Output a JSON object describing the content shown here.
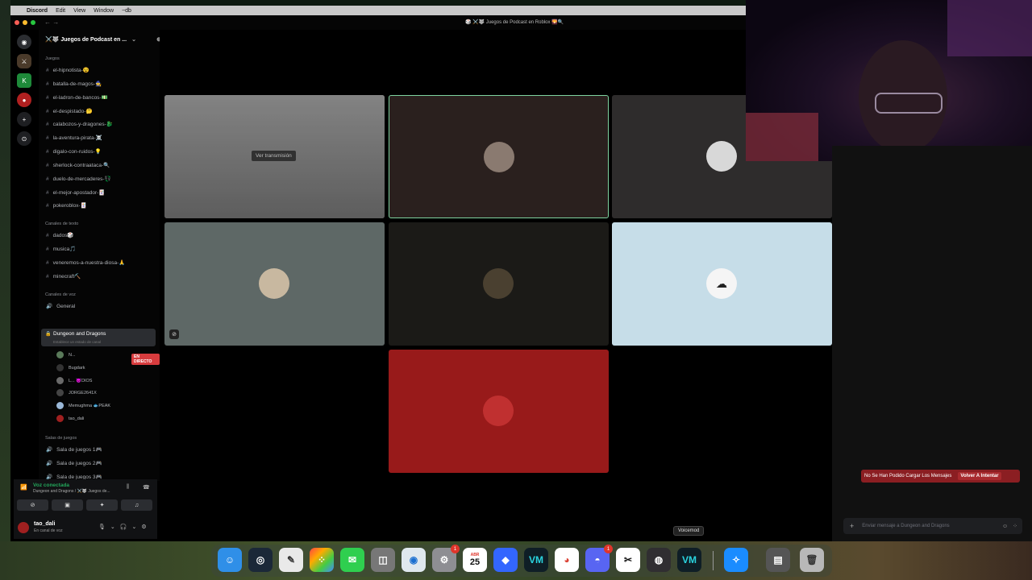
{
  "menubar": {
    "app": "Discord",
    "items": [
      "Edit",
      "View",
      "Window",
      "~db"
    ]
  },
  "window": {
    "title": "🎲 ⚔️🐺 Juegos de Podcast en Roblox 🌄🔍"
  },
  "server": {
    "name": "⚔️🐺 Juegos de Podcast en ..."
  },
  "categories": {
    "juegos": "Juegos",
    "texto": "Canales de texto",
    "voz": "Canales de voz",
    "salas": "Salas de juegos"
  },
  "channels_juegos": [
    "el-hipnotista-😵",
    "batalla-de-magos-🧙",
    "el-ladron-de-bancos-💵",
    "el-despistado-🤔",
    "calabozos-y-dragones-🐉",
    "la-aventura-pirata-☠️",
    "digalo-con-ruidos-💡",
    "sherlock-contraataca-🔍",
    "duelo-de-mercaderes-💱",
    "el-mejor-apostador-🃏",
    "pokeroblox-🃏"
  ],
  "channels_texto": [
    "dados🎲",
    "musica🎵",
    "veneremos-a-nuestra-diosa-🙏",
    "minecraft⛏️"
  ],
  "channels_voz": {
    "general": "General",
    "active": "Dungeon and Dragons",
    "active_sub": "Establece un estado de canal"
  },
  "voice_users": [
    {
      "name": "N...",
      "color": "#5a7a5a"
    },
    {
      "name": "Bugdark",
      "color": "#333333"
    },
    {
      "name": "L... 😈DIOS",
      "color": "#6a6a6a"
    },
    {
      "name": "JORGE2641X",
      "color": "#444444"
    },
    {
      "name": "Memughma 🐟PEAK",
      "color": "#9ab8d8"
    },
    {
      "name": "tao_dali",
      "color": "#a02020"
    }
  ],
  "live_badge": "EN DIRECTO",
  "channels_salas": [
    "Sala de juegos 1🎮",
    "Sala de juegos 2🎮",
    "Sala de juegos 3🎮"
  ],
  "voice_panel": {
    "title": "Voz conectada",
    "subtitle": "Dungeon and Dragons / ⚔️🐺 Juegos de..."
  },
  "user": {
    "name": "tao_dali",
    "status": "En canal de voz"
  },
  "call": {
    "stream_button": "Ver transmisión"
  },
  "chat": {
    "error": "No Se Han Podido Cargar Los Mensajes",
    "retry": "Volver A Intentar",
    "placeholder": "Enviar mensaje a Dungeon and Dragons"
  },
  "dock": {
    "tooltip": "Voicemod",
    "calendar_month": "ABR",
    "calendar_day": "25",
    "badge_settings": "1",
    "badge_discord": "1"
  },
  "colors": {
    "accent_green": "#23a55a",
    "live_red": "#d83c3e",
    "tile_speaking_border": "#7ed3a0"
  }
}
